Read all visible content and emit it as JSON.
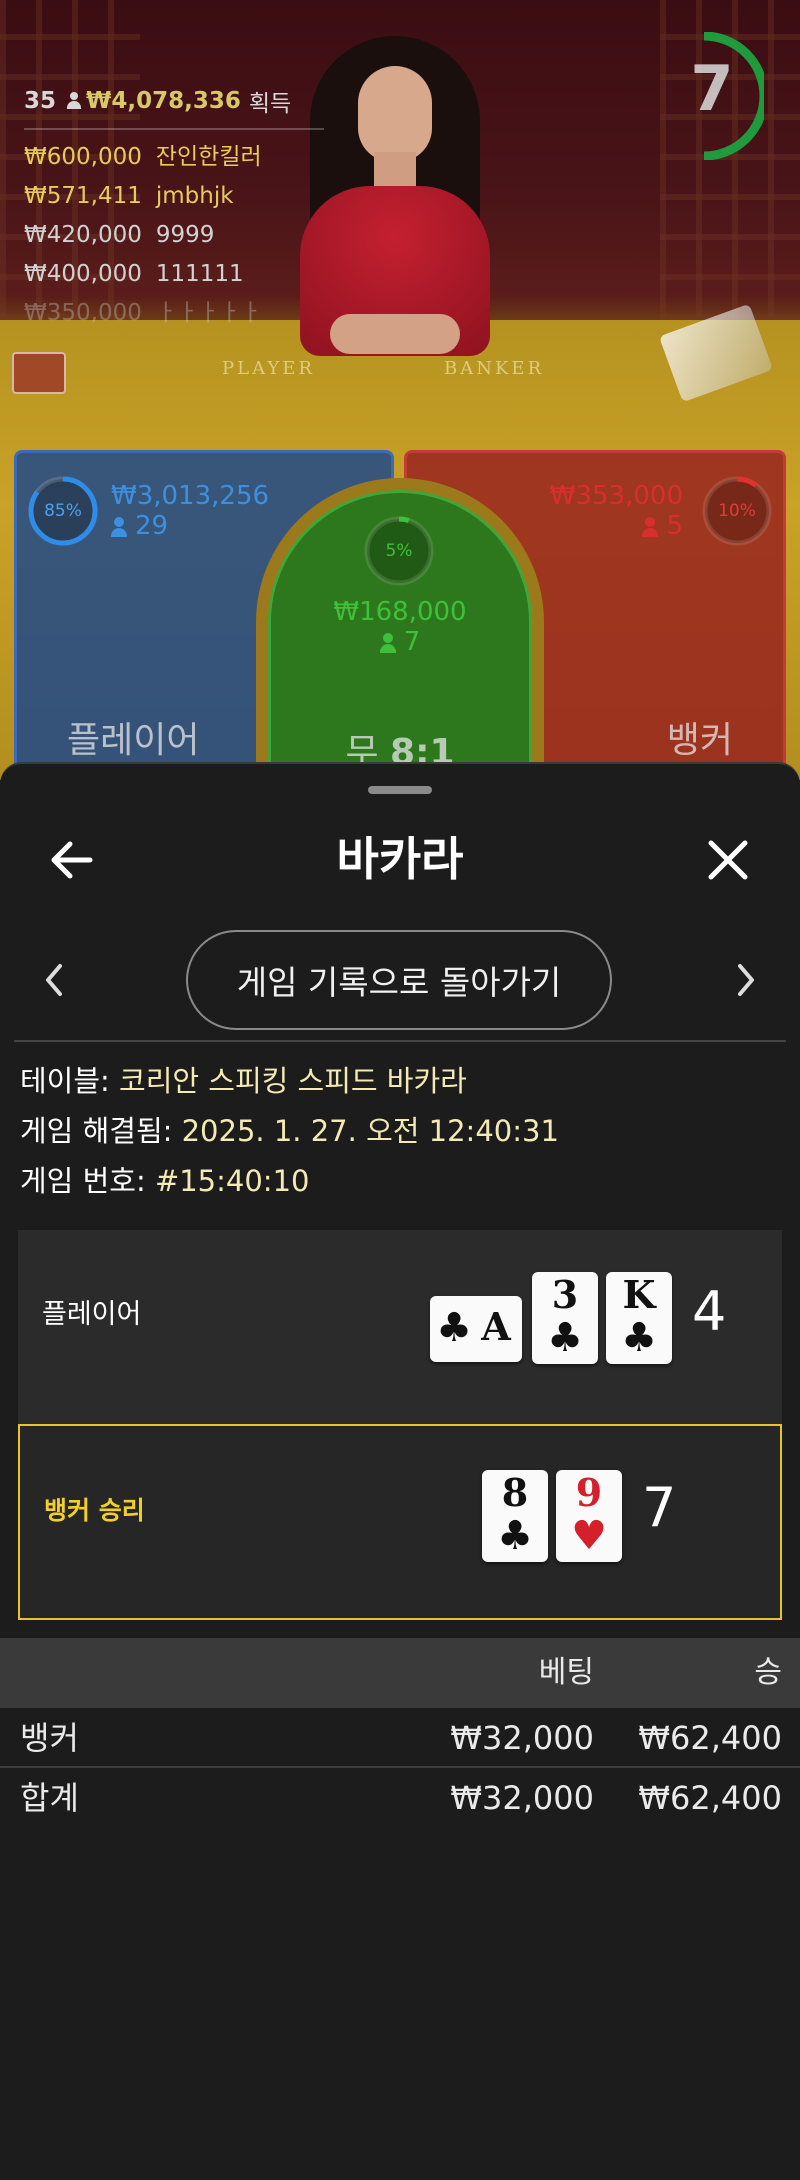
{
  "stage": {
    "timer": "7",
    "winners": {
      "count": "35",
      "total": "₩4,078,336",
      "label": "획득",
      "rows": [
        {
          "amount": "₩600,000",
          "user": "잔인한킬러"
        },
        {
          "amount": "₩571,411",
          "user": "jmbhjk"
        },
        {
          "amount": "₩420,000",
          "user": "9999"
        },
        {
          "amount": "₩400,000",
          "user": "111111"
        },
        {
          "amount": "₩350,000",
          "user": "ㅏㅏㅏㅏㅏ"
        }
      ]
    },
    "felt_text": {
      "player": "PLAYER",
      "banker": "BANKER"
    },
    "bets": {
      "player": {
        "percent": "85%",
        "amount": "₩3,013,256",
        "players": "29",
        "label": "플레이어"
      },
      "tie": {
        "percent": "5%",
        "amount": "₩168,000",
        "players": "7",
        "label": "무",
        "odds": "8:1"
      },
      "banker": {
        "percent": "10%",
        "amount": "₩353,000",
        "players": "5",
        "label": "뱅커"
      }
    },
    "colors": {
      "player": "#1f5fb0",
      "tie": "#2fa82a",
      "banker": "#c22525",
      "timer": "#1f9a3c"
    }
  },
  "sheet": {
    "title": "바카라",
    "back_to_history": "게임 기록으로 돌아가기",
    "meta": {
      "table_key": "테이블:",
      "table_val": "코리안 스피킹 스피드 바카라",
      "resolved_key": "게임 해결됨:",
      "resolved_val": "2025. 1. 27. 오전 12:40:31",
      "number_key": "게임 번호:",
      "number_val": "#15:40:10"
    },
    "player_hand": {
      "label": "플레이어",
      "score": "4",
      "cards": [
        {
          "rank": "A",
          "suit": "♣"
        },
        {
          "rank": "3",
          "suit": "♣"
        },
        {
          "rank": "K",
          "suit": "♣"
        }
      ]
    },
    "banker_hand": {
      "label": "뱅커 승리",
      "score": "7",
      "cards": [
        {
          "rank": "8",
          "suit": "♣"
        },
        {
          "rank": "9",
          "suit": "♥"
        }
      ]
    },
    "results": {
      "headers": {
        "bet": "베팅",
        "win": "승"
      },
      "rows": [
        {
          "label": "뱅커",
          "bet": "₩32,000",
          "win": "₩62,400"
        },
        {
          "label": "합계",
          "bet": "₩32,000",
          "win": "₩62,400"
        }
      ]
    }
  }
}
